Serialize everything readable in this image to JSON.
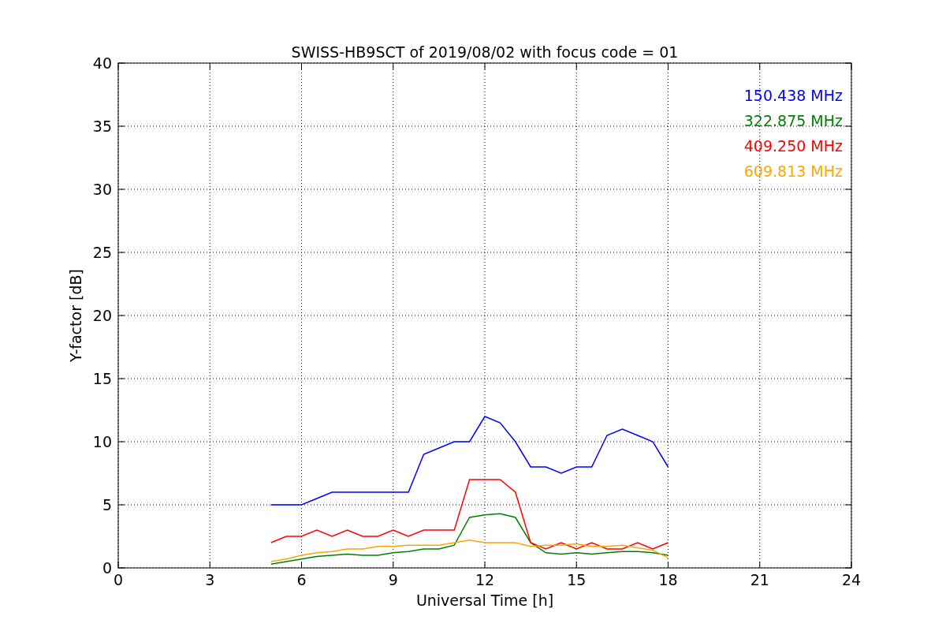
{
  "figure": {
    "chart_data": {
      "type": "line",
      "title": "SWISS-HB9SCT of 2019/08/02 with focus code = 01",
      "xlabel": "Universal Time [h]",
      "ylabel": "Y-factor [dB]",
      "x": [
        5,
        5.5,
        6,
        6.5,
        7,
        7.5,
        8,
        8.5,
        9,
        9.5,
        10,
        10.5,
        11,
        11.5,
        12,
        12.5,
        13,
        13.5,
        14,
        14.5,
        15,
        15.5,
        16,
        16.5,
        17,
        17.5,
        18
      ],
      "series": [
        {
          "name": "150.438 MHz",
          "color": "#0000ff",
          "values": [
            5,
            5,
            5,
            5.5,
            6,
            6,
            6,
            6,
            6,
            6,
            9,
            9.5,
            10,
            10,
            12,
            11.5,
            10,
            8,
            8,
            7.5,
            8,
            8,
            10.5,
            11,
            10.5,
            10,
            8
          ]
        },
        {
          "name": "322.875 MHz",
          "color": "#008000",
          "values": [
            0.3,
            0.5,
            0.7,
            0.9,
            1,
            1.1,
            1,
            1,
            1.2,
            1.3,
            1.5,
            1.5,
            1.8,
            4,
            4.2,
            4.3,
            4,
            2,
            1.2,
            1.1,
            1.2,
            1.1,
            1.2,
            1.3,
            1.3,
            1.2,
            1
          ]
        },
        {
          "name": "409.250 MHz",
          "color": "#ff0000",
          "values": [
            2,
            2.5,
            2.5,
            3,
            2.5,
            3,
            2.5,
            2.5,
            3,
            2.5,
            3,
            3,
            3,
            7,
            7,
            7,
            6,
            2,
            1.5,
            2,
            1.5,
            2,
            1.5,
            1.5,
            2,
            1.5,
            2
          ]
        },
        {
          "name": "609.813 MHz",
          "color": "#ffa500",
          "values": [
            0.5,
            0.7,
            1,
            1.2,
            1.3,
            1.5,
            1.5,
            1.7,
            1.7,
            1.8,
            1.8,
            1.8,
            2,
            2.2,
            2,
            2,
            2,
            1.7,
            1.8,
            1.8,
            1.9,
            1.7,
            1.7,
            1.8,
            1.6,
            1.4,
            0.8
          ]
        }
      ],
      "grid": true,
      "xlim": [
        0,
        24
      ],
      "ylim": [
        0,
        40
      ],
      "xticks": [
        0,
        3,
        6,
        9,
        12,
        15,
        18,
        21,
        24
      ],
      "yticks": [
        0,
        5,
        10,
        15,
        20,
        25,
        30,
        35,
        40
      ]
    }
  }
}
